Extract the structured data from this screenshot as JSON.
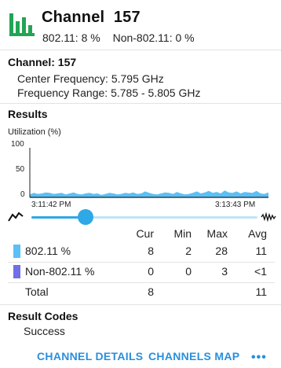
{
  "header": {
    "icon": "bar-chart-icon",
    "title_prefix": "Channel",
    "title_channel": "157",
    "wifi_label": "802.11:",
    "wifi_value": "8 %",
    "non_wifi_label": "Non-802.11:",
    "non_wifi_value": "0 %"
  },
  "channel_info": {
    "label": "Channel:",
    "value": "157",
    "center_freq_label": "Center Frequency:",
    "center_freq_value": "5.795 GHz",
    "freq_range_label": "Frequency Range:",
    "freq_range_value": "5.785 - 5.805 GHz"
  },
  "results": {
    "heading": "Results",
    "chart_ylabel": "Utilization (%)",
    "ytick_top": "100",
    "ytick_mid": "50",
    "ytick_bottom": "0",
    "time_start": "3:11:42 PM",
    "time_end": "3:13:43 PM",
    "slider_level": 0.24,
    "columns": [
      "Cur",
      "Min",
      "Max",
      "Avg"
    ],
    "rows": [
      {
        "label": "802.11 %",
        "cur": "8",
        "min": "2",
        "max": "28",
        "avg": "11",
        "color": "#5bc0f5"
      },
      {
        "label": "Non-802.11 %",
        "cur": "0",
        "min": "0",
        "max": "3",
        "avg": "<1",
        "color": "#6f6fe8"
      },
      {
        "label": "Total",
        "cur": "8",
        "min": "",
        "max": "",
        "avg": "11"
      }
    ]
  },
  "chart_data": {
    "type": "area",
    "xlabel": "",
    "ylabel": "Utilization (%)",
    "ylim": [
      0,
      100
    ],
    "x": [
      "3:11:42 PM",
      "3:13:43 PM"
    ],
    "series": [
      {
        "name": "802.11 %",
        "color": "#5bc0f5",
        "values": [
          6,
          9,
          7,
          8,
          10,
          9,
          7,
          8,
          9,
          6,
          8,
          10,
          7,
          6,
          8,
          9,
          7,
          8,
          5,
          7,
          9,
          8,
          6,
          7,
          9,
          8,
          10,
          7,
          8,
          12,
          9,
          7,
          6,
          8,
          10,
          9,
          7,
          11,
          8,
          6,
          7,
          9,
          12,
          8,
          10,
          13,
          9,
          11,
          8,
          14,
          10,
          9,
          12,
          8,
          11,
          10,
          9,
          13,
          8,
          7,
          10
        ]
      },
      {
        "name": "Non-802.11 %",
        "color": "#6f6fe8",
        "values": [
          0,
          0,
          0,
          0,
          0,
          0,
          0,
          0,
          0,
          0,
          0,
          0,
          0,
          0,
          0,
          0,
          0,
          0,
          0,
          0,
          0,
          0,
          0,
          0,
          0,
          0,
          0,
          0,
          0,
          0,
          0,
          0,
          0,
          0,
          0,
          0,
          0,
          0,
          0,
          0,
          0,
          0,
          0,
          0,
          0,
          0,
          0,
          0,
          0,
          0,
          0,
          0,
          0,
          0,
          0,
          0,
          0,
          0,
          0,
          0,
          0
        ]
      }
    ],
    "grid": false,
    "legend": "none"
  },
  "result_codes": {
    "heading": "Result Codes",
    "value": "Success"
  },
  "actions": {
    "channel_details": "CHANNEL DETAILS",
    "channels_map": "CHANNELS MAP",
    "more": "•••"
  },
  "colors": {
    "accent": "#2a8fdc",
    "slider": "#2ea8e6",
    "icon_green": "#23a455"
  }
}
